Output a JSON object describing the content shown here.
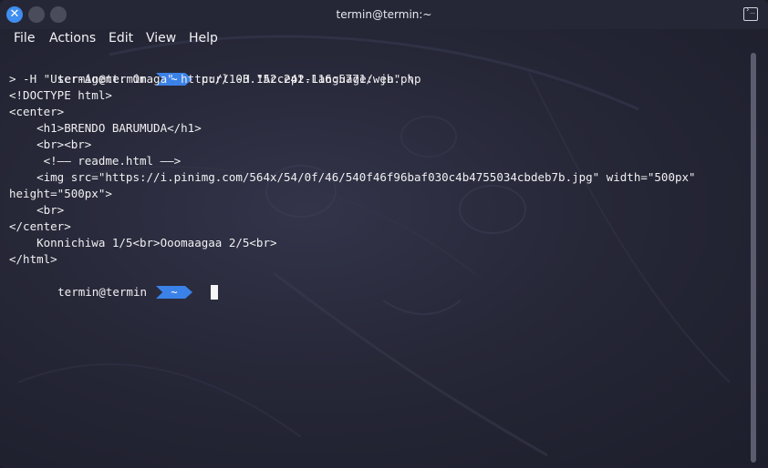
{
  "window": {
    "title": "termin@termin:~",
    "close_glyph": "✕",
    "terminal_icon": "terminal-icon"
  },
  "menu": {
    "items": [
      "File",
      "Actions",
      "Edit",
      "View",
      "Help"
    ]
  },
  "terminal": {
    "prompt_user": "termin@termin",
    "prompt_dir": "~",
    "lines": [
      {
        "type": "prompt",
        "command": "curl -H \"Accept-Language: ja\" \\"
      },
      {
        "type": "text",
        "text": "> -H \"User-Agent: Omaga\" http://103.152.242.116:5771/web.php"
      },
      {
        "type": "text",
        "text": "<!DOCTYPE html>"
      },
      {
        "type": "text",
        "text": "<center>"
      },
      {
        "type": "text",
        "text": "    <h1>BRENDO BARUMUDA</h1>"
      },
      {
        "type": "text",
        "text": "    <br><br>"
      },
      {
        "type": "text",
        "text": "     <!—— readme.html ——>"
      },
      {
        "type": "text",
        "text": "    <img src=\"https://i.pinimg.com/564x/54/0f/46/540f46f96baf030c4b4755034cbdeb7b.jpg\" width=\"500px\""
      },
      {
        "type": "text",
        "text": "height=\"500px\">"
      },
      {
        "type": "text",
        "text": "    <br>"
      },
      {
        "type": "text",
        "text": "</center>"
      },
      {
        "type": "text",
        "text": "    Konnichiwa 1/5<br>Ooomaagaa 2/5<br>"
      },
      {
        "type": "text",
        "text": "</html>"
      },
      {
        "type": "prompt",
        "command": ""
      }
    ]
  },
  "colors": {
    "accent": "#3b82e8",
    "close_button": "#3f8ef0",
    "text": "#f0f0f2"
  }
}
